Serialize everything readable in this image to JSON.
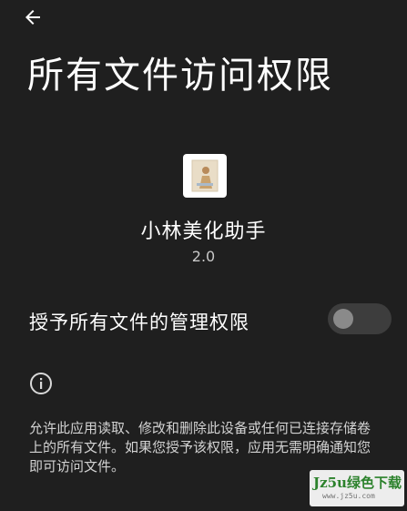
{
  "header": {
    "back_icon": "arrow-left-icon",
    "title": "所有文件访问权限"
  },
  "app": {
    "icon": "app-thumbnail-icon",
    "name": "小林美化助手",
    "version": "2.0"
  },
  "permission": {
    "label": "授予所有文件的管理权限",
    "enabled": false
  },
  "info": {
    "icon": "info-icon",
    "description": "允许此应用读取、修改和删除此设备或任何已连接存储卷上的所有文件。如果您授予该权限，应用无需明确通知您即可访问文件。"
  },
  "watermark": {
    "text": "Jz5u绿色下载",
    "subtext": "www.jz5u.com"
  },
  "colors": {
    "background": "#1f1f1f",
    "toggle_track": "#3d3d3d",
    "toggle_knob": "#8a8a8a",
    "watermark_green": "#2e8b2e"
  }
}
